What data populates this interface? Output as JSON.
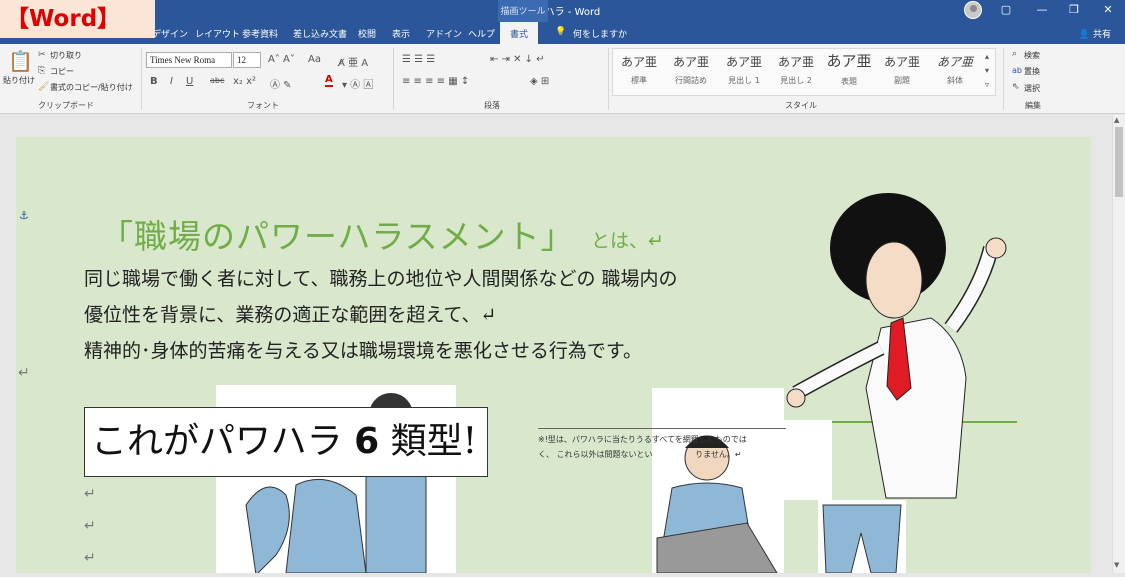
{
  "badge": "【Word】",
  "window": {
    "title": "パワハラ  -  Word",
    "tool_tab_header": "描画ツール",
    "controls": [
      "▢",
      "—",
      "❐",
      "✕"
    ]
  },
  "tabs": [
    {
      "label": "デザイン"
    },
    {
      "label": "レイアウト"
    },
    {
      "label": "参考資料"
    },
    {
      "label": "差し込み文書"
    },
    {
      "label": "校閲"
    },
    {
      "label": "表示"
    },
    {
      "label": "アドイン"
    },
    {
      "label": "ヘルプ"
    },
    {
      "label": "書式"
    },
    {
      "label": "何をしますか"
    }
  ],
  "share": "共有",
  "ribbon": {
    "clipboard": {
      "paste": "貼り付け",
      "cut": "切り取り",
      "copy": "コピー",
      "format_painter": "書式のコピー/貼り付け",
      "label": "クリップボード"
    },
    "font": {
      "name": "Times New Roma",
      "size": "12",
      "label": "フォント"
    },
    "paragraph": {
      "label": "段落"
    },
    "styles": {
      "label": "スタイル",
      "items": [
        {
          "sample": "あア亜",
          "name": "標準"
        },
        {
          "sample": "あア亜",
          "name": "行間詰め"
        },
        {
          "sample": "あア亜",
          "name": "見出し 1"
        },
        {
          "sample": "あア亜",
          "name": "見出し 2"
        },
        {
          "sample": "あア亜",
          "name": "表題"
        },
        {
          "sample": "あア亜",
          "name": "副題"
        },
        {
          "sample": "あア亜",
          "name": "斜体"
        }
      ]
    },
    "editing": {
      "find": "検索",
      "replace": "置換",
      "select": "選択",
      "label": "編集"
    }
  },
  "doc": {
    "heading": "「職場のパワーハラスメント」",
    "heading_suffix": "とは、↵",
    "lines": [
      "同じ職場で働く者に対して、職務上の地位や人間関係などの 職場内の",
      "優位性を背景に、業務の適正な範囲を超えて、↵",
      "精神的･身体的苦痛を与える又は職場環境を悪化させる行為です。"
    ],
    "callout_pre": "これがパワハラ",
    "callout_num": "6",
    "callout_post": "類型!",
    "note_line1": "※!型は、パワハラに当たりうるすべてを網羅したものでは",
    "note_line2": "く、 これら以外は問題ないとい",
    "note_line3": "りません。↵"
  },
  "colors": {
    "title_bar": "#2b579a",
    "page_bg": "#d9e8cc",
    "heading": "#70ad47",
    "badge_text": "#e00000",
    "badge_bg": "#fbe5d6"
  }
}
